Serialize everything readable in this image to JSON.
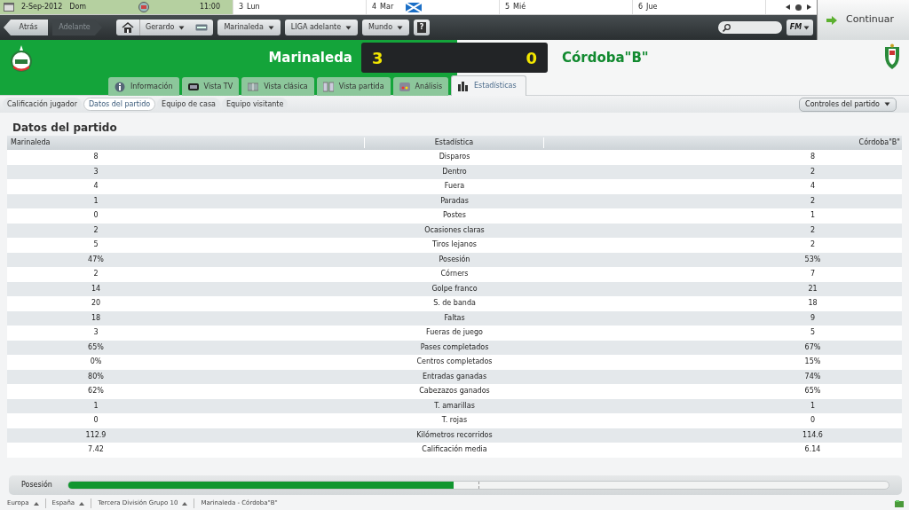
{
  "calendar": {
    "current": {
      "date": "2-Sep-2012",
      "day": "Dom",
      "time": "11:00"
    },
    "days": [
      {
        "num": "3",
        "day": "Lun",
        "flag": false
      },
      {
        "num": "4",
        "day": "Mar",
        "flag": true
      },
      {
        "num": "5",
        "day": "Mié",
        "flag": false
      },
      {
        "num": "6",
        "day": "Jue",
        "flag": false
      }
    ]
  },
  "continue_button": "Continuar",
  "toolbar": {
    "back": "Atrás",
    "forward": {
      "label": "Adelante",
      "disabled": true
    },
    "menus": [
      {
        "label": "Gerardo",
        "kind": "home"
      },
      {
        "label": "Marinaleda",
        "kind": "plain"
      },
      {
        "label": "LIGA adelante",
        "kind": "plain"
      },
      {
        "label": "Mundo",
        "kind": "plain"
      }
    ],
    "help": "?",
    "fm_button": "FM"
  },
  "match": {
    "home": "Marinaleda",
    "home_score": "3",
    "away_score": "0",
    "away": "Córdoba\"B\""
  },
  "tabs": [
    {
      "label": "Información",
      "kind": "info",
      "selected": false
    },
    {
      "label": "Vista TV",
      "kind": "tv",
      "selected": false
    },
    {
      "label": "Vista clásica",
      "kind": "pitch",
      "selected": false
    },
    {
      "label": "Vista partida",
      "kind": "split",
      "selected": false
    },
    {
      "label": "Análisis",
      "kind": "analysis",
      "selected": false
    },
    {
      "label": "Estadísticas",
      "kind": "bars",
      "selected": true
    }
  ],
  "subtabs": [
    {
      "label": "Calificación jugador",
      "selected": false
    },
    {
      "label": "Datos del partido",
      "selected": true
    },
    {
      "label": "Equipo de casa",
      "selected": false
    },
    {
      "label": "Equipo visitante",
      "selected": false
    }
  ],
  "controls_button": "Controles del partido",
  "section_title": "Datos del partido",
  "table": {
    "columns": [
      "Marinaleda",
      "Estadística",
      "Córdoba\"B\""
    ],
    "rows": [
      [
        "8",
        "Disparos",
        "8"
      ],
      [
        "3",
        "Dentro",
        "2"
      ],
      [
        "4",
        "Fuera",
        "4"
      ],
      [
        "1",
        "Paradas",
        "2"
      ],
      [
        "0",
        "Postes",
        "1"
      ],
      [
        "2",
        "Ocasiones claras",
        "2"
      ],
      [
        "5",
        "Tiros lejanos",
        "2"
      ],
      [
        "47%",
        "Posesión",
        "53%"
      ],
      [
        "2",
        "Córners",
        "7"
      ],
      [
        "14",
        "Golpe franco",
        "21"
      ],
      [
        "20",
        "S. de banda",
        "18"
      ],
      [
        "18",
        "Faltas",
        "9"
      ],
      [
        "3",
        "Fueras de juego",
        "5"
      ],
      [
        "65%",
        "Pases completados",
        "67%"
      ],
      [
        "0%",
        "Centros completados",
        "15%"
      ],
      [
        "80%",
        "Entradas ganadas",
        "74%"
      ],
      [
        "62%",
        "Cabezazos ganados",
        "65%"
      ],
      [
        "1",
        "T. amarillas",
        "1"
      ],
      [
        "0",
        "T. rojas",
        "0"
      ],
      [
        "112.9",
        "Kilómetros recorridos",
        "114.6"
      ],
      [
        "7.42",
        "Calificación media",
        "6.14"
      ]
    ]
  },
  "possession": {
    "label": "Posesión",
    "level": 0.47
  },
  "status_bar": [
    "Europa",
    "España",
    "Tercera División Grupo 10",
    "Marinaleda - Córdoba\"B\""
  ]
}
